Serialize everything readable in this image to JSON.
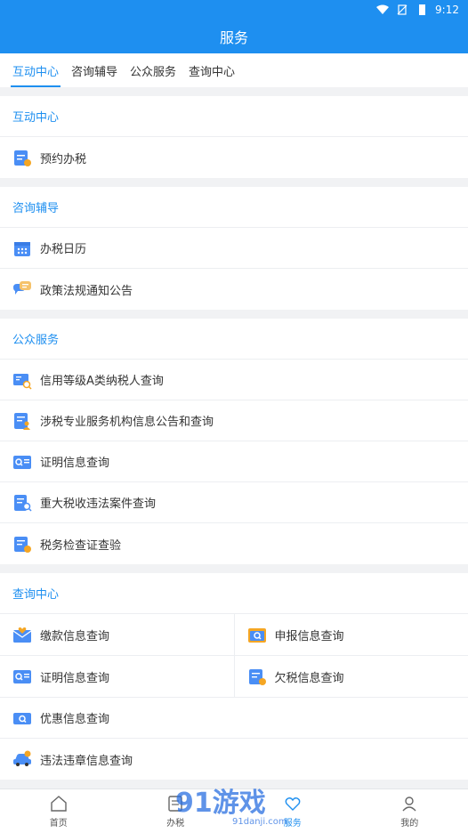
{
  "status_bar": {
    "time": "9:12"
  },
  "header": {
    "title": "服务"
  },
  "tabs": [
    {
      "label": "互动中心",
      "active": true
    },
    {
      "label": "咨询辅导",
      "active": false
    },
    {
      "label": "公众服务",
      "active": false
    },
    {
      "label": "查询中心",
      "active": false
    }
  ],
  "sections": {
    "interact": {
      "title": "互动中心",
      "items": [
        {
          "label": "预约办税",
          "icon": "calendar-clock-icon"
        }
      ]
    },
    "consult": {
      "title": "咨询辅导",
      "items": [
        {
          "label": "办税日历",
          "icon": "calendar-icon"
        },
        {
          "label": "政策法规通知公告",
          "icon": "chat-icon"
        }
      ]
    },
    "public": {
      "title": "公众服务",
      "items": [
        {
          "label": "信用等级A类纳税人查询",
          "icon": "credit-search-icon"
        },
        {
          "label": "涉税专业服务机构信息公告和查询",
          "icon": "agency-doc-icon"
        },
        {
          "label": "证明信息查询",
          "icon": "certificate-search-icon"
        },
        {
          "label": "重大税收违法案件查询",
          "icon": "case-search-icon"
        },
        {
          "label": "税务检查证查验",
          "icon": "inspection-icon"
        }
      ]
    },
    "query": {
      "title": "查询中心",
      "grid": [
        {
          "label": "缴款信息查询",
          "icon": "envelope-heart-icon"
        },
        {
          "label": "申报信息查询",
          "icon": "folder-search-icon"
        },
        {
          "label": "证明信息查询",
          "icon": "certificate-search-icon"
        },
        {
          "label": "欠税信息查询",
          "icon": "arrears-doc-icon"
        }
      ],
      "items": [
        {
          "label": "优惠信息查询",
          "icon": "coupon-search-icon"
        },
        {
          "label": "违法违章信息查询",
          "icon": "car-icon"
        }
      ]
    }
  },
  "bottom_nav": [
    {
      "label": "首页",
      "icon": "home-icon",
      "active": false
    },
    {
      "label": "办税",
      "icon": "document-icon",
      "active": false
    },
    {
      "label": "服务",
      "icon": "heart-icon",
      "active": true
    },
    {
      "label": "我的",
      "icon": "user-icon",
      "active": false
    }
  ],
  "watermark": {
    "logo": "91游戏",
    "site": "91danji.com"
  },
  "colors": {
    "primary": "#1e8ff0",
    "icon_blue": "#4a8ef5",
    "icon_orange": "#f5a623"
  }
}
